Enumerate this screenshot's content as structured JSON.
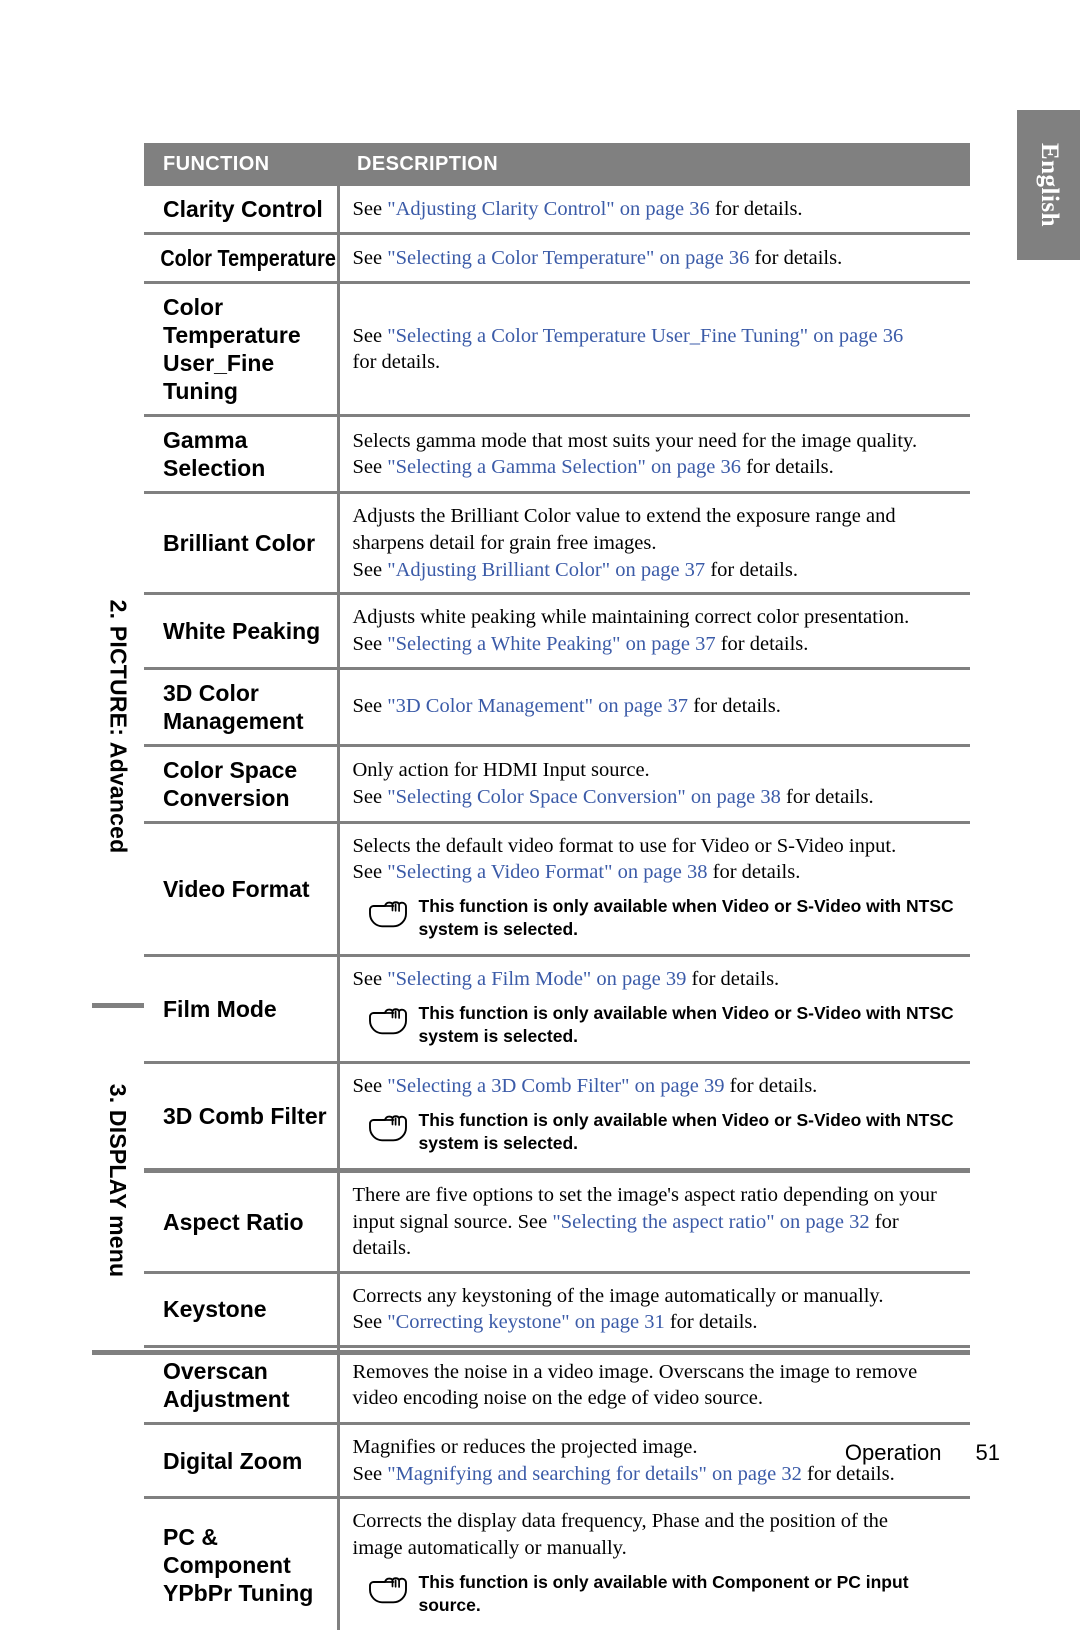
{
  "language_tab": {
    "label": "English"
  },
  "footer": {
    "section_label": "Operation",
    "page_number": "51"
  },
  "table": {
    "headers": {
      "function": "FUNCTION",
      "description": "DESCRIPTION"
    },
    "section_labels": {
      "picture": "2. PICTURE: Advanced",
      "display": "3. DISPLAY menu"
    },
    "rows": [
      {
        "function": "Clarity Control",
        "lines": [
          [
            {
              "t": "See ",
              "link": false
            },
            {
              "t": "\"Adjusting Clarity Control\" on page 36",
              "link": true
            },
            {
              "t": " for details.",
              "link": false
            }
          ]
        ]
      },
      {
        "function": "Color Temperature",
        "lines": [
          [
            {
              "t": "See ",
              "link": false
            },
            {
              "t": "\"Selecting a Color Temperature\" on page 36",
              "link": true
            },
            {
              "t": " for details.",
              "link": false
            }
          ]
        ]
      },
      {
        "function": "Color Temperature User_Fine Tuning",
        "lines": [
          [
            {
              "t": "See ",
              "link": false
            },
            {
              "t": "\"Selecting a Color Temperature User_Fine Tuning\" on page 36",
              "link": true
            }
          ],
          [
            {
              "t": "for details.",
              "link": false
            }
          ]
        ]
      },
      {
        "function": "Gamma Selection",
        "lines": [
          [
            {
              "t": "Selects gamma mode that most suits your need for the image quality.",
              "link": false
            }
          ],
          [
            {
              "t": "See ",
              "link": false
            },
            {
              "t": "\"Selecting a Gamma Selection\" on page 36",
              "link": true
            },
            {
              "t": " for details.",
              "link": false
            }
          ]
        ]
      },
      {
        "function": "Brilliant Color",
        "lines": [
          [
            {
              "t": "Adjusts the Brilliant Color value to extend the exposure range and",
              "link": false
            }
          ],
          [
            {
              "t": "sharpens detail for grain free images.",
              "link": false
            }
          ],
          [
            {
              "t": "See ",
              "link": false
            },
            {
              "t": "\"Adjusting Brilliant Color\" on page 37",
              "link": true
            },
            {
              "t": " for details.",
              "link": false
            }
          ]
        ]
      },
      {
        "function": "White Peaking",
        "lines": [
          [
            {
              "t": "Adjusts white peaking while maintaining correct color presentation.",
              "link": false
            }
          ],
          [
            {
              "t": "See ",
              "link": false
            },
            {
              "t": "\"Selecting a White Peaking\" on page 37",
              "link": true
            },
            {
              "t": " for details.",
              "link": false
            }
          ]
        ]
      },
      {
        "function": "3D Color Management",
        "lines": [
          [
            {
              "t": "See ",
              "link": false
            },
            {
              "t": "\"3D Color Management\" on page 37",
              "link": true
            },
            {
              "t": " for details.",
              "link": false
            }
          ]
        ]
      },
      {
        "function": "Color Space Conversion",
        "lines": [
          [
            {
              "t": "Only action for HDMI Input source.",
              "link": false
            }
          ],
          [
            {
              "t": "See ",
              "link": false
            },
            {
              "t": "\"Selecting Color Space Conversion\" on page 38",
              "link": true
            },
            {
              "t": " for details.",
              "link": false
            }
          ]
        ]
      },
      {
        "function": "Video Format",
        "lines": [
          [
            {
              "t": "Selects the default video format to use for Video or S-Video input.",
              "link": false
            }
          ],
          [
            {
              "t": "See ",
              "link": false
            },
            {
              "t": "\"Selecting a Video Format\" on page 38",
              "link": true
            },
            {
              "t": " for details.",
              "link": false
            }
          ]
        ],
        "note": [
          "This function is only available when Video or S-Video with NTSC",
          "system is selected."
        ]
      },
      {
        "function": "Film Mode",
        "lines": [
          [
            {
              "t": "See ",
              "link": false
            },
            {
              "t": "\"Selecting a Film Mode\" on page 39",
              "link": true
            },
            {
              "t": " for details.",
              "link": false
            }
          ]
        ],
        "note": [
          "This function is only available when Video or S-Video with NTSC",
          "system is selected."
        ]
      },
      {
        "function": "3D Comb Filter",
        "lines": [
          [
            {
              "t": "See ",
              "link": false
            },
            {
              "t": "\"Selecting a 3D Comb Filter\" on page 39",
              "link": true
            },
            {
              "t": " for details.",
              "link": false
            }
          ]
        ],
        "note": [
          "This function is only available when Video or S-Video with NTSC",
          "system is selected."
        ]
      },
      {
        "function": "Aspect Ratio",
        "section_break": true,
        "lines": [
          [
            {
              "t": "There are five options to set the image's aspect ratio depending on your",
              "link": false
            }
          ],
          [
            {
              "t": "input signal source. See ",
              "link": false
            },
            {
              "t": "\"Selecting the aspect ratio\" on page 32",
              "link": true
            },
            {
              "t": " for details.",
              "link": false
            }
          ]
        ]
      },
      {
        "function": "Keystone",
        "lines": [
          [
            {
              "t": "Corrects any keystoning of the image automatically or manually.",
              "link": false
            }
          ],
          [
            {
              "t": "See ",
              "link": false
            },
            {
              "t": "\"Correcting keystone\" on page 31",
              "link": true
            },
            {
              "t": " for details.",
              "link": false
            }
          ]
        ]
      },
      {
        "function": "Overscan Adjustment",
        "lines": [
          [
            {
              "t": "Removes the noise in a video image. Overscans the image to remove",
              "link": false
            }
          ],
          [
            {
              "t": "video encoding noise on the edge of video source.",
              "link": false
            }
          ]
        ]
      },
      {
        "function": "Digital Zoom",
        "lines": [
          [
            {
              "t": "Magnifies or reduces the projected image.",
              "link": false
            }
          ],
          [
            {
              "t": "See ",
              "link": false
            },
            {
              "t": "\"Magnifying and searching for details\" on page 32",
              "link": true
            },
            {
              "t": " for details.",
              "link": false
            }
          ]
        ]
      },
      {
        "function": "PC & Component YPbPr Tuning",
        "lines": [
          [
            {
              "t": "Corrects the display data frequency, Phase and the position of the",
              "link": false
            }
          ],
          [
            {
              "t": "image automatically or manually.",
              "link": false
            }
          ]
        ],
        "note": [
          "This function is only available with Component or PC input",
          "source."
        ]
      }
    ]
  },
  "colors": {
    "header_gray": "#808080",
    "rule_gray": "#808080",
    "link_blue": "#3B5BA8",
    "text_black": "#000000"
  }
}
